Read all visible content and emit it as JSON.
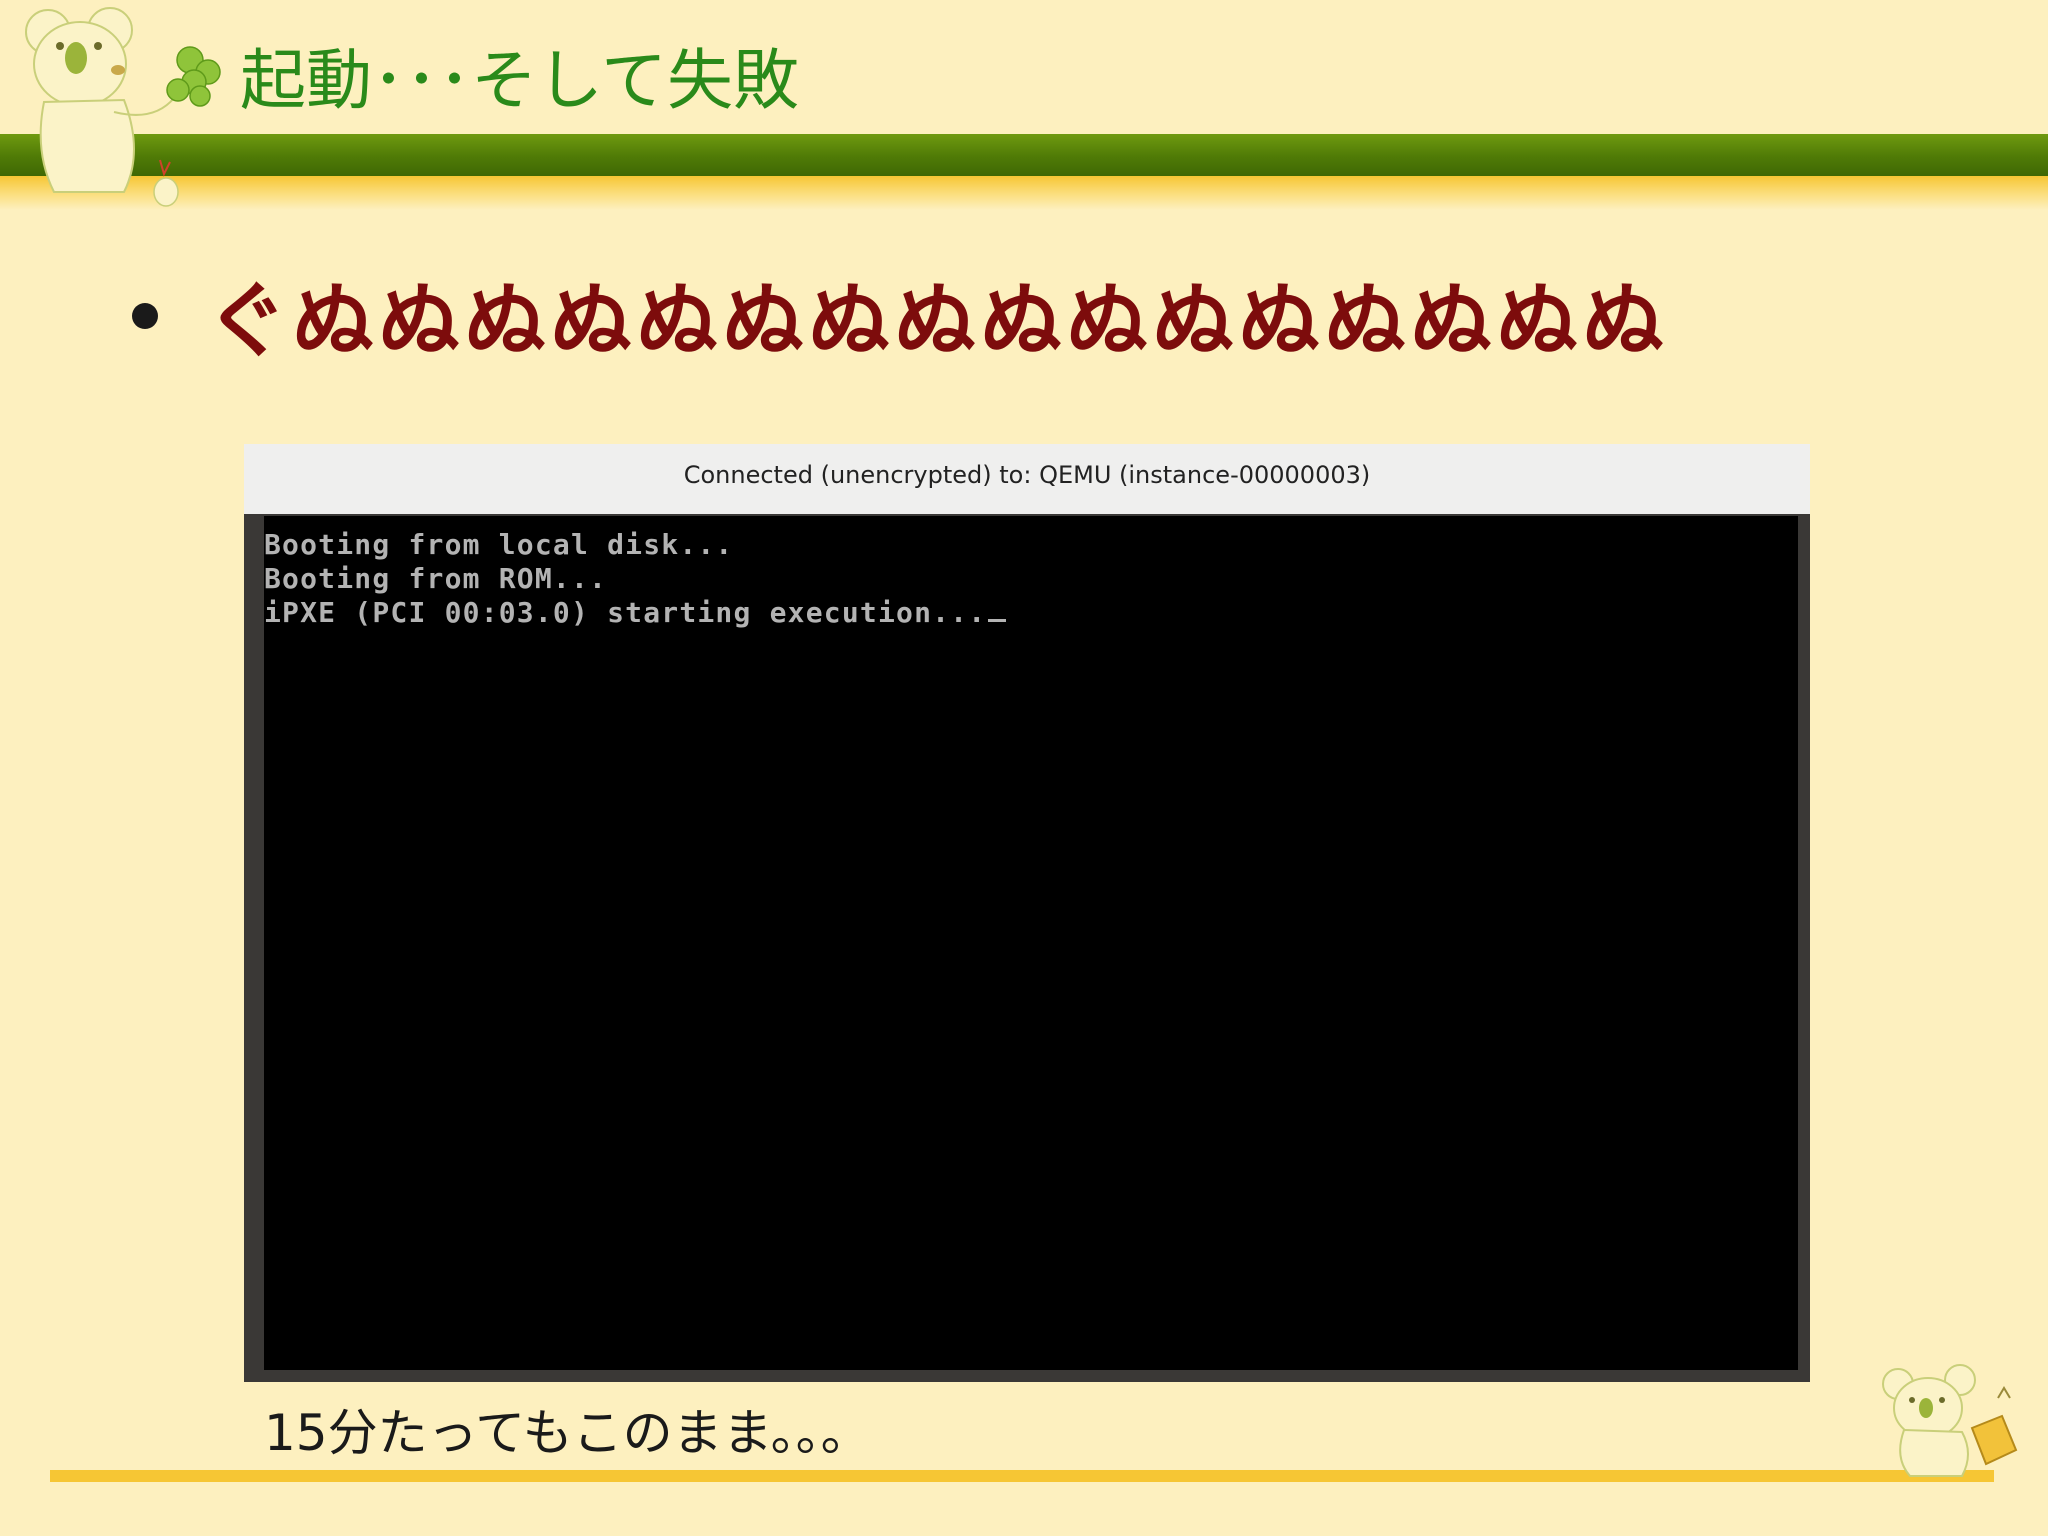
{
  "slide": {
    "title": "起動･･･そして失敗",
    "bullet": "ぐぬぬぬぬぬぬぬぬぬぬぬぬぬぬぬぬ",
    "caption": "15分たってもこのまま。。。"
  },
  "vnc": {
    "title": "Connected (unencrypted) to: QEMU (instance-00000003)",
    "console_lines": [
      "Booting from local disk...",
      "Booting from ROM...",
      "iPXE (PCI 00:03.0) starting execution..."
    ]
  },
  "colors": {
    "background": "#fdf0bf",
    "title": "#2a8a1a",
    "bullet_text": "#7d0c0c",
    "band_green": "#4f7a06",
    "band_yellow": "#f6c634",
    "console_text": "#b3b3b3"
  },
  "icons": [
    "koala-mascot-top-icon",
    "koala-mascot-bottom-icon"
  ]
}
